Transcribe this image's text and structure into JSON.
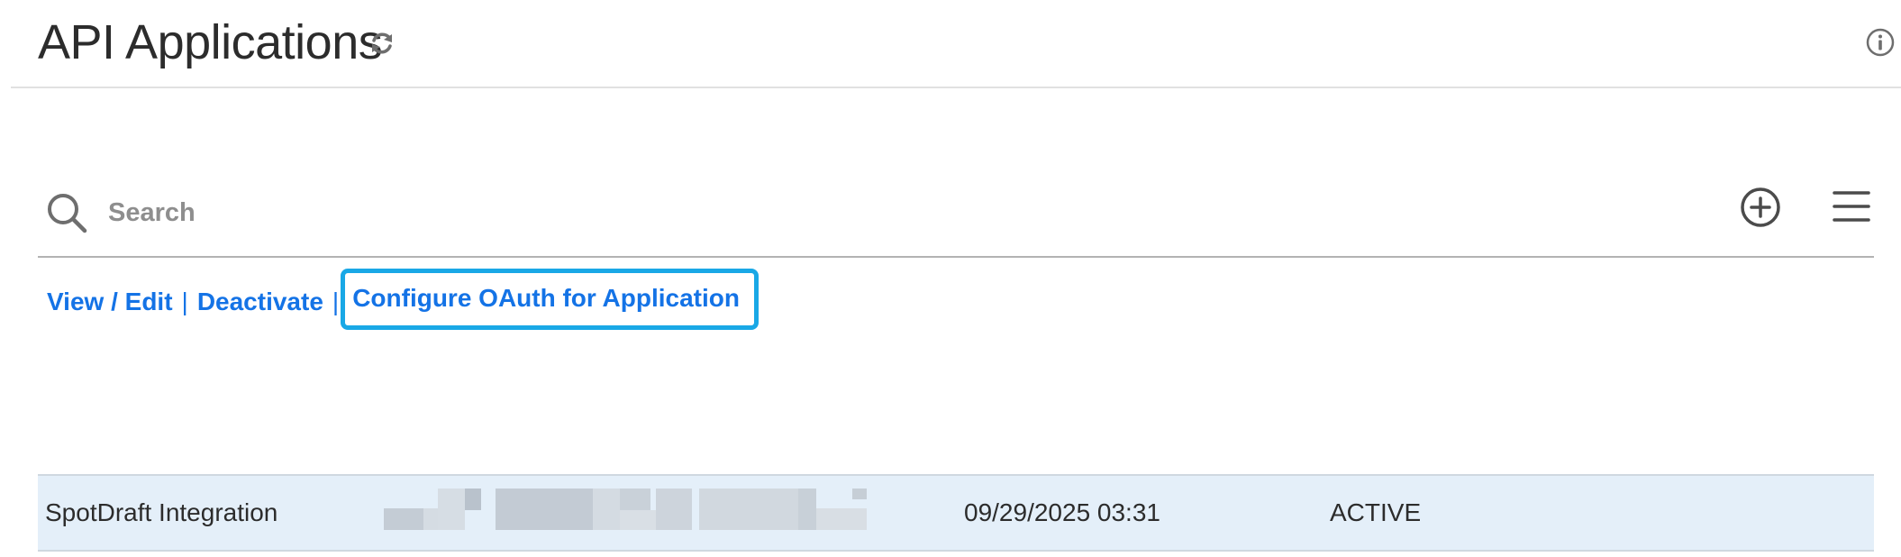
{
  "header": {
    "title": "API Applications",
    "refresh_icon": "refresh-icon",
    "info_icon": "info-icon"
  },
  "search": {
    "placeholder": "Search",
    "value": "",
    "icon": "search-icon"
  },
  "toolbar": {
    "add_icon": "plus-circle-icon",
    "menu_icon": "hamburger-menu-icon"
  },
  "actions": {
    "view_edit": "View / Edit",
    "separator": "|",
    "deactivate": "Deactivate",
    "configure_oauth": "Configure OAuth for Application"
  },
  "colors": {
    "link": "#1473e6",
    "highlight_border": "#19a8e6",
    "selected_row": "#e4eff9"
  },
  "rows": [
    {
      "name": "SpotDraft Integration",
      "id": "",
      "date": "09/29/2025 03:31",
      "status": "ACTIVE",
      "selected": true
    }
  ]
}
